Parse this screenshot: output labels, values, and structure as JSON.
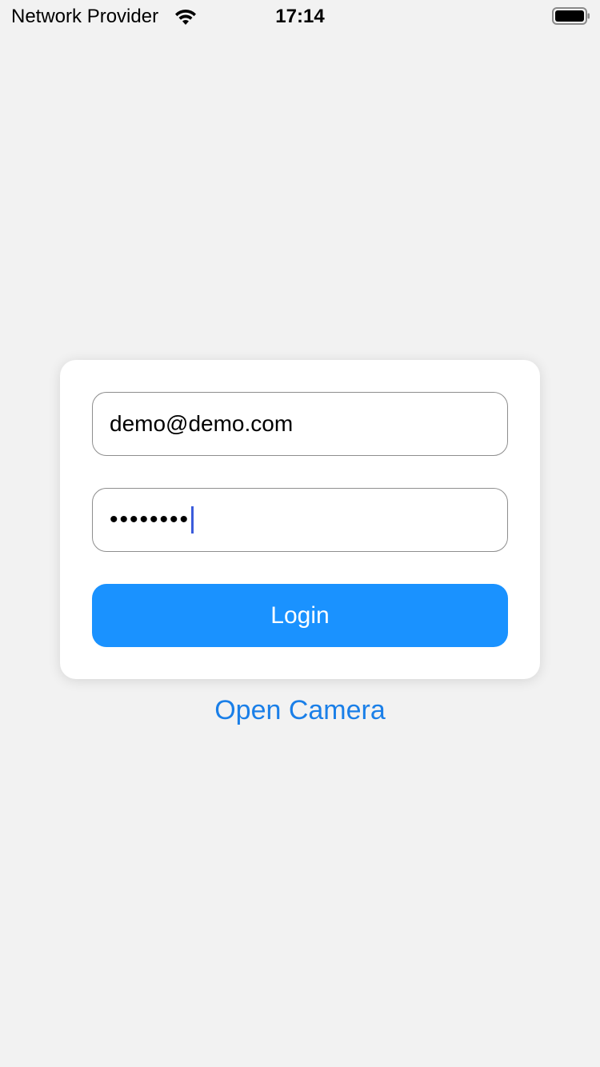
{
  "status_bar": {
    "carrier": "Network Provider",
    "time": "17:14",
    "wifi_icon": "wifi-icon",
    "battery_icon": "battery-icon"
  },
  "login_form": {
    "email_value": "demo@demo.com",
    "password_value": "••••••••",
    "login_label": "Login",
    "accent_color": "#1a92ff"
  },
  "links": {
    "open_camera_label": "Open Camera",
    "link_color": "#1a7fe8"
  }
}
